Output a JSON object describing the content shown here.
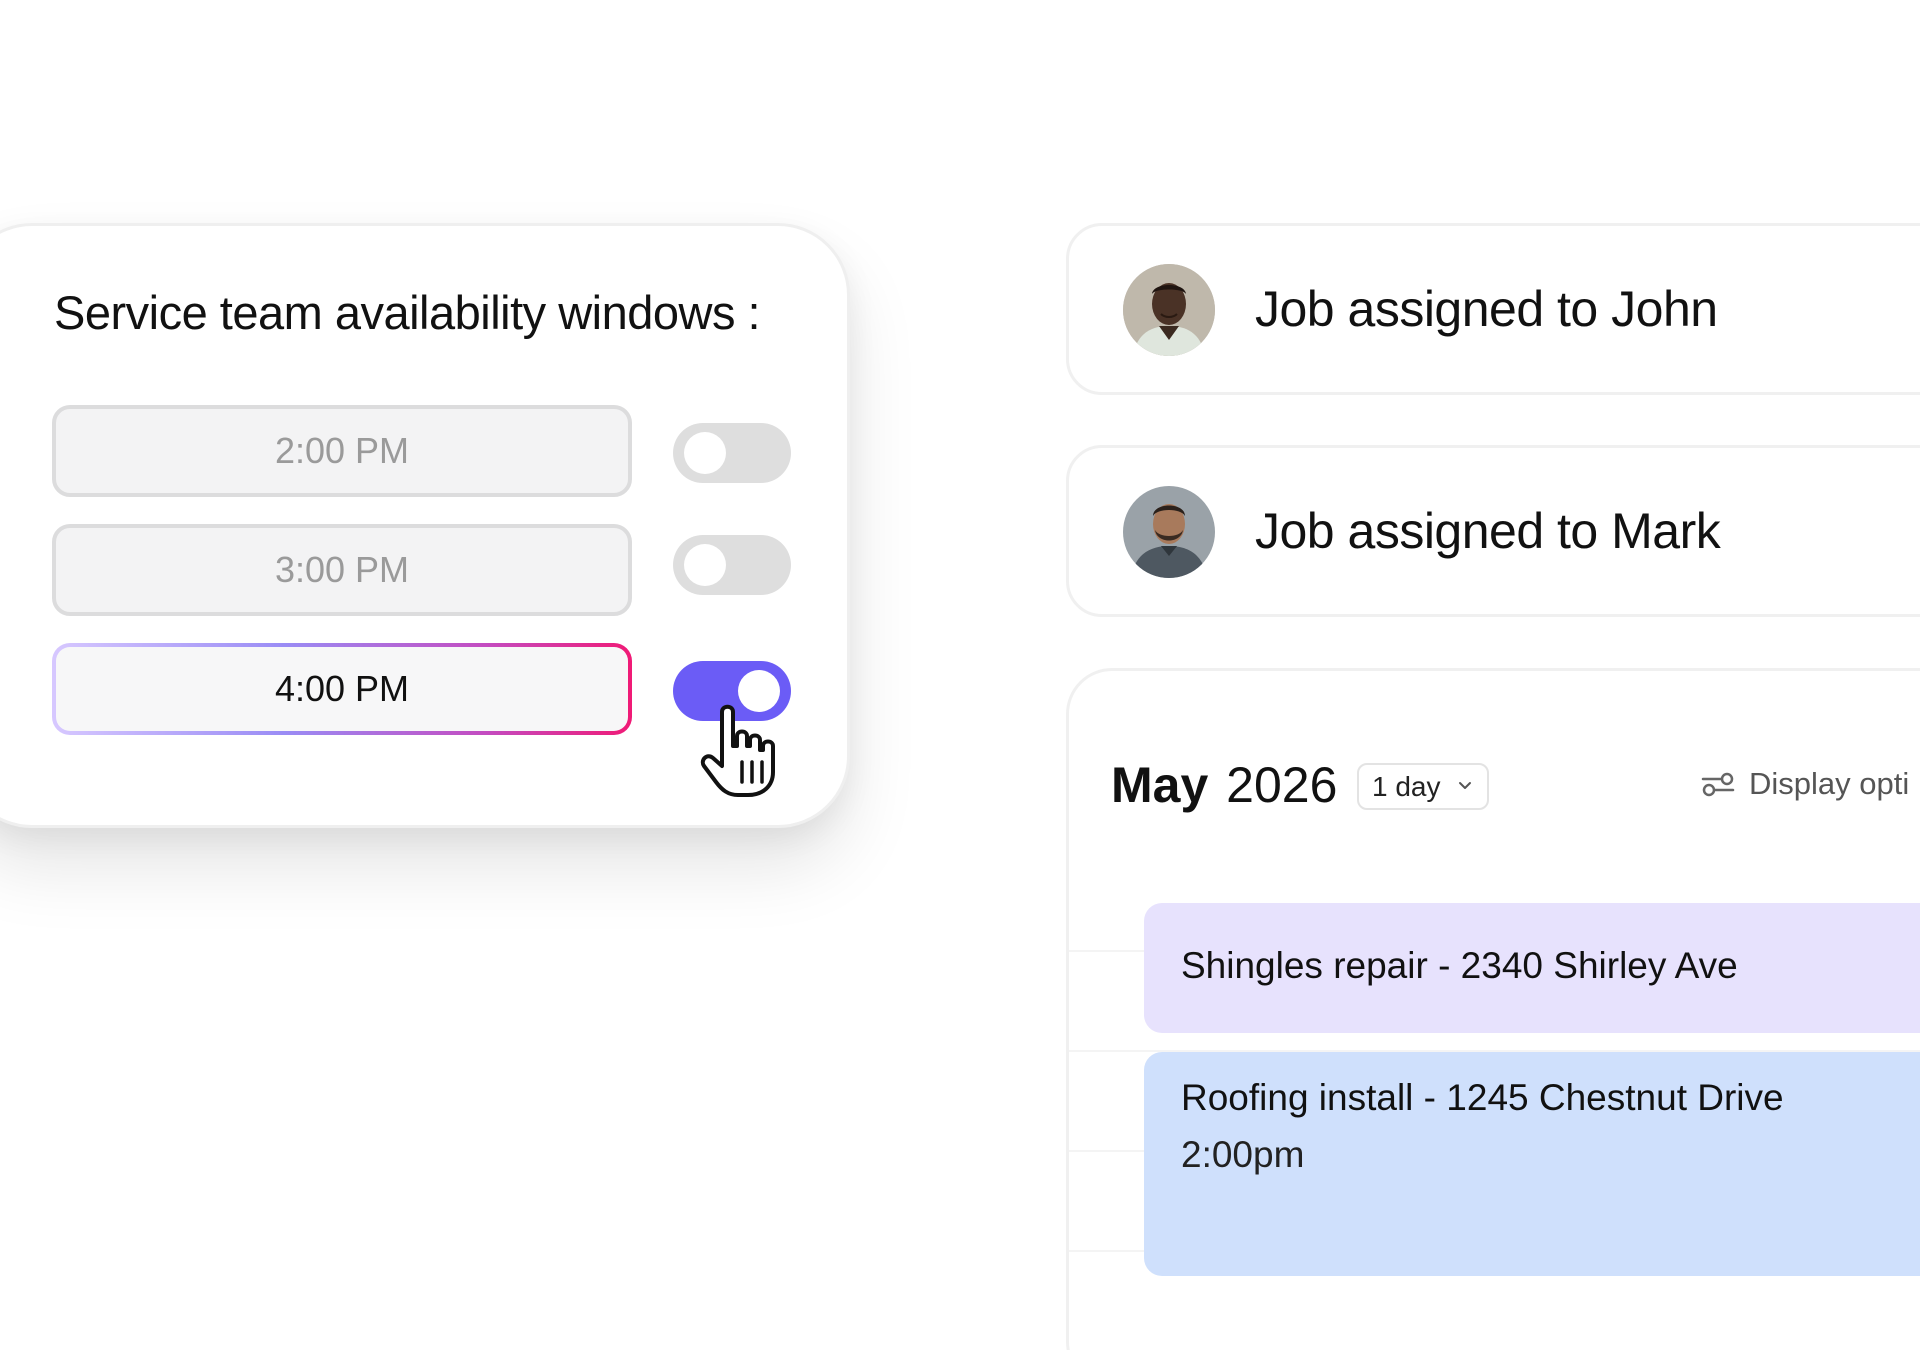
{
  "availability": {
    "title": "Service team availability windows :",
    "slots": [
      {
        "time": "2:00 PM",
        "enabled": false
      },
      {
        "time": "3:00 PM",
        "enabled": false
      },
      {
        "time": "4:00 PM",
        "enabled": true
      }
    ]
  },
  "assignments": [
    {
      "text": "Job assigned to John",
      "avatar": "avatar-john"
    },
    {
      "text": "Job assigned to Mark",
      "avatar": "avatar-mark"
    }
  ],
  "calendar": {
    "month": "May",
    "year": "2026",
    "range_label": "1 day",
    "display_options_label": "Display opti",
    "events": [
      {
        "title": "Shingles repair - 2340 Shirley Ave",
        "time": ""
      },
      {
        "title": "Roofing install - 1245 Chestnut Drive",
        "time": "2:00pm"
      }
    ]
  },
  "colors": {
    "toggle_on": "#6b5cf6",
    "event_purple": "#e7e2fd",
    "event_blue": "#cfe0fc",
    "selected_border_gradient": [
      "#d7c8ff",
      "#f01a76"
    ]
  },
  "icons": {
    "cursor": "hand-pointer-icon",
    "dropdown": "chevron-down-icon",
    "display_options": "sliders-icon"
  }
}
